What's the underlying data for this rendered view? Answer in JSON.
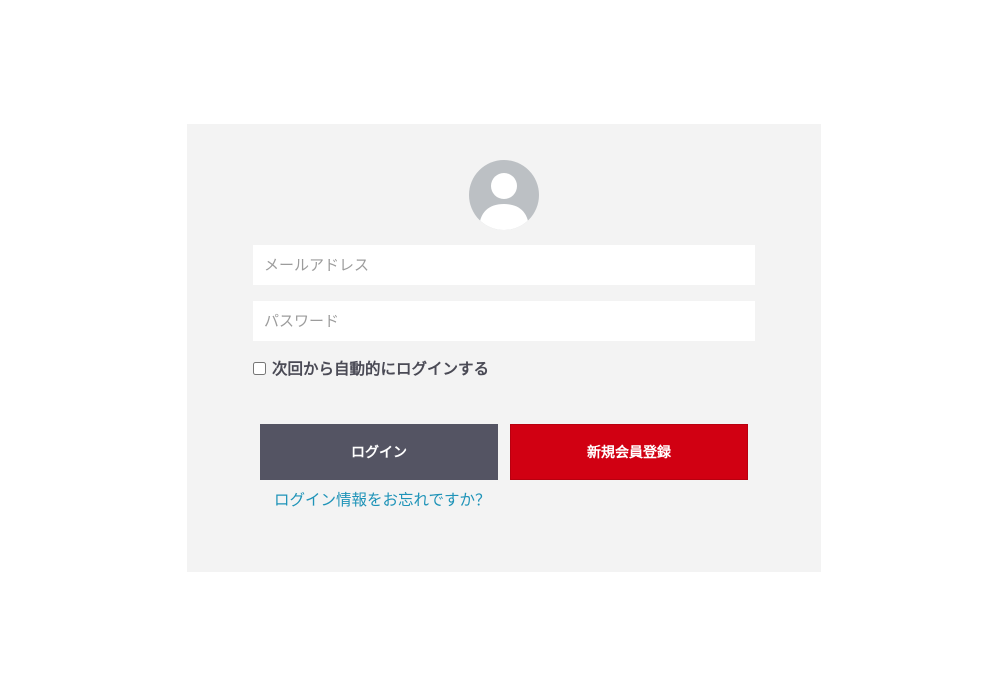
{
  "login_form": {
    "avatar_icon": "user-silhouette-icon",
    "email": {
      "value": "",
      "placeholder": "メールアドレス"
    },
    "password": {
      "value": "",
      "placeholder": "パスワード"
    },
    "remember_me": {
      "label": "次回から自動的にログインする",
      "checked": false
    },
    "login_button_label": "ログイン",
    "register_button_label": "新規会員登録",
    "forgot_link_text": "ログイン情報をお忘れですか？"
  },
  "colors": {
    "panel_background": "#f3f3f3",
    "avatar_background": "#bcc0c4",
    "login_button": "#545463",
    "register_button": "#d10012",
    "link": "#1e93b8"
  }
}
